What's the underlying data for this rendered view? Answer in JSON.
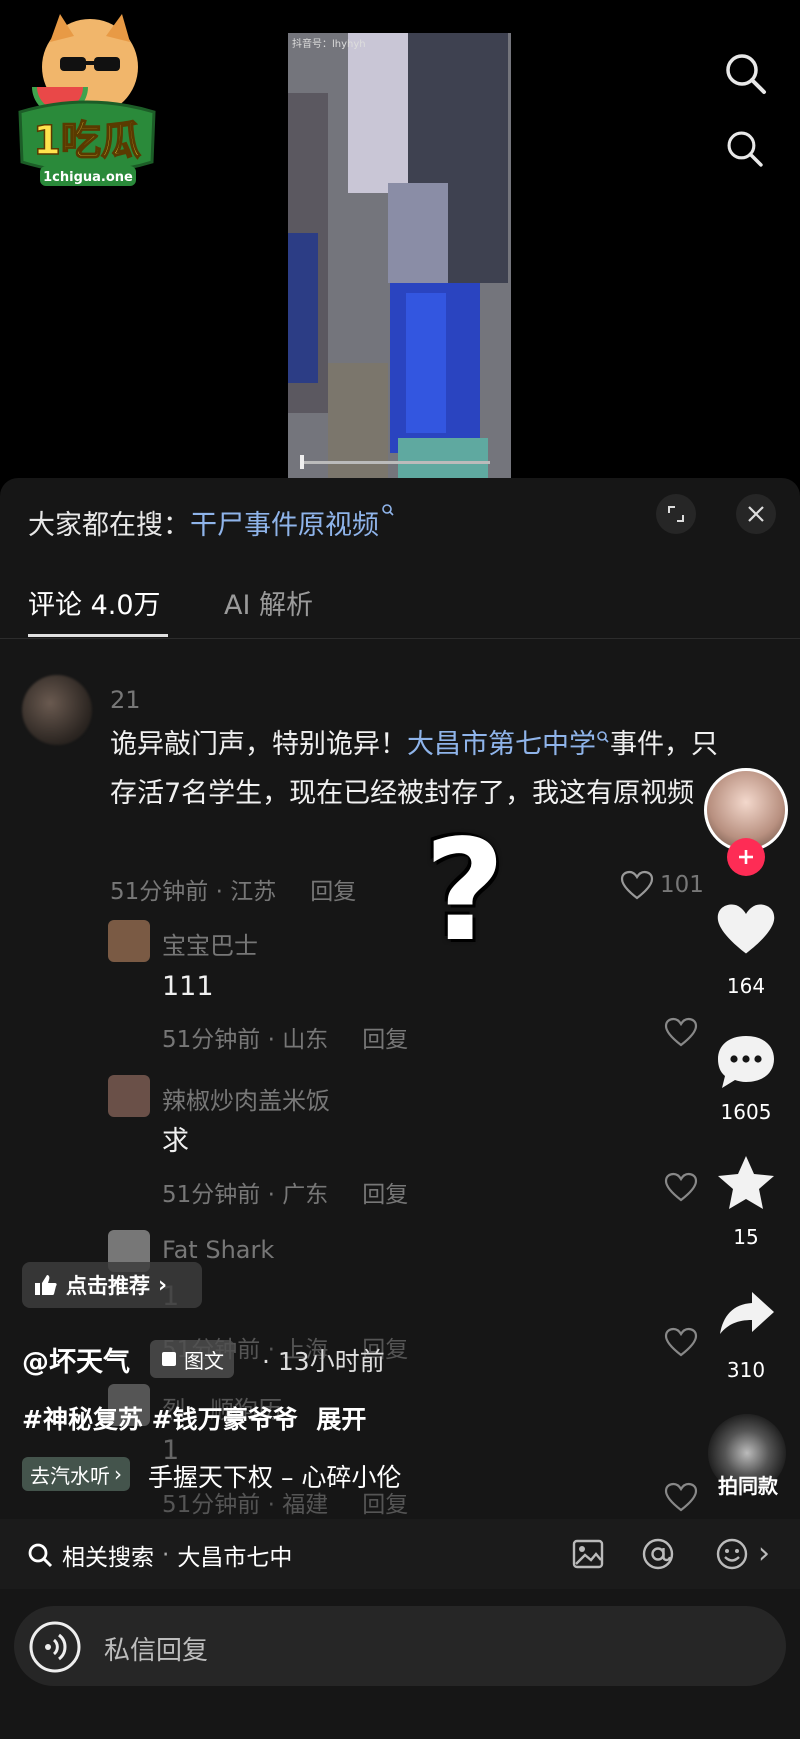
{
  "logo": {
    "brand_text": "1吃瓜",
    "domain_text": "1chigua.one"
  },
  "video": {
    "watermark": "抖音号：lhyhyh"
  },
  "panel": {
    "title_prefix": "大家都在搜：",
    "title_link": "干尸事件原视频"
  },
  "tabs": [
    {
      "label": "评论 4.0万",
      "active": true
    },
    {
      "label": "AI 解析",
      "active": false
    }
  ],
  "comments": [
    {
      "username": "21",
      "text_a": "诡异敲门声，特别诡异！",
      "text_link": "大昌市第七中学",
      "text_b": "事件，只存活7名学生，现在已经被封存了，我这有原视频",
      "time_region": "51分钟前 · 江苏",
      "reply_label": "回复",
      "likes": "101"
    },
    {
      "username": "宝宝巴士",
      "text": "111",
      "time_region": "51分钟前 · 山东",
      "reply_label": "回复"
    },
    {
      "username": "辣椒炒肉盖米饭",
      "text": "求",
      "time_region": "51分钟前 · 广东",
      "reply_label": "回复"
    },
    {
      "username": "Fat Shark",
      "text": "1",
      "time_region": "51分钟前 · 上海",
      "reply_label": "回复"
    },
    {
      "username": "烈　顺狗历",
      "text": "1",
      "time_region": "51分钟前 · 福建",
      "reply_label": "回复"
    }
  ],
  "overlay_question": "?",
  "rail": {
    "likes": "164",
    "comments": "1605",
    "favorites": "15",
    "shares": "310",
    "remix_label": "拍同款"
  },
  "post": {
    "recommend_label": "点击推荐",
    "author": "@坏天气",
    "type_label": "图文",
    "time": "· 13小时前",
    "tags": "#神秘复苏 #钱万豪爷爷",
    "expand_label": "展开",
    "music_chip": "去汽水听",
    "music_title": "手握天下权 – 心碎小伦"
  },
  "related_search": {
    "label": "相关搜索",
    "query": "大昌市七中"
  },
  "reply_bar": {
    "placeholder": "私信回复"
  },
  "colors": {
    "link": "#8fb4ea",
    "like_badge": "#fe2c55"
  }
}
